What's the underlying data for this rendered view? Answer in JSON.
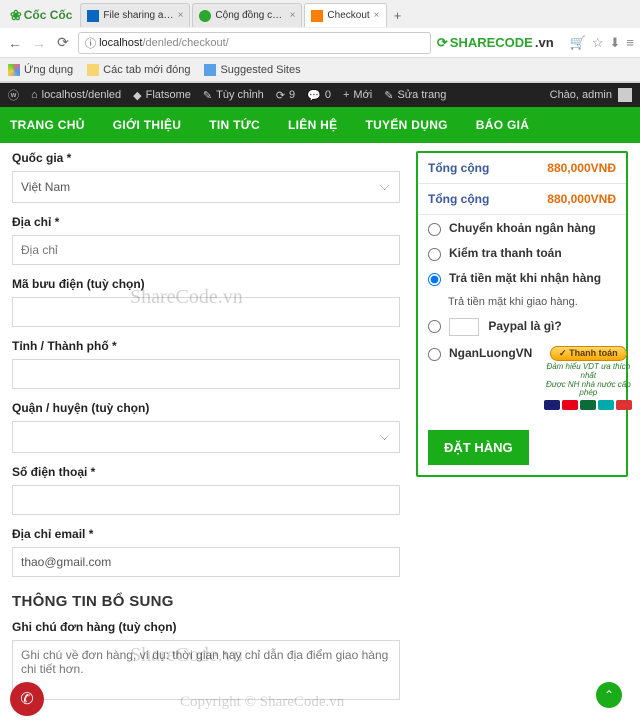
{
  "browser": {
    "app_name": "Cốc Cốc",
    "tabs": [
      {
        "label": "File sharing and storage m",
        "favicon_color": "#0b66c3"
      },
      {
        "label": "Cộng đồng chia sẻ và do",
        "favicon_color": "#2ea52e"
      },
      {
        "label": "Checkout",
        "favicon_color": "#ff7e00",
        "active": true
      }
    ],
    "new_tab": "+",
    "url_info_icon": "ⓘ",
    "url_host": "localhost",
    "url_path": "/denled/checkout/",
    "bookmarks": [
      {
        "label": "Ứng dụng"
      },
      {
        "label": "Các tab mới đóng"
      },
      {
        "label": "Suggested Sites"
      }
    ]
  },
  "watermark": {
    "brand": "SHARECODE",
    "suffix": ".vn"
  },
  "wp_bar": {
    "site": "localhost/denled",
    "items": [
      "Flatsome",
      "Tùy chỉnh"
    ],
    "comments": "0",
    "updates": "9",
    "new": "Mới",
    "edit": "Sửa trang",
    "greeting": "Chào, admin"
  },
  "nav": [
    "TRANG CHỦ",
    "GIỚI THIỆU",
    "TIN TỨC",
    "LIÊN HỆ",
    "TUYỂN DỤNG",
    "BÁO GIÁ"
  ],
  "form": {
    "country_label": "Quốc gia *",
    "country_value": "Việt Nam",
    "address_label": "Địa chỉ *",
    "address_placeholder": "Địa chỉ",
    "zip_label": "Mã bưu điện (tuỳ chọn)",
    "city_label": "Tỉnh / Thành phố *",
    "district_label": "Quận / huyện (tuỳ chọn)",
    "phone_label": "Số điện thoại *",
    "email_label": "Địa chỉ email *",
    "email_value": "thao@gmail.com",
    "extra_heading": "THÔNG TIN BỔ SUNG",
    "notes_label": "Ghi chú đơn hàng (tuỳ chọn)",
    "notes_placeholder": "Ghi chú về đơn hàng, ví dụ: thời gian hay chỉ dẫn địa điểm giao hàng chi tiết hơn."
  },
  "summary": {
    "rows": [
      {
        "k": "Tổng cộng",
        "v": "880,000VNĐ"
      },
      {
        "k": "Tổng cộng",
        "v": "880,000VNĐ"
      }
    ],
    "payments": {
      "bank": "Chuyển khoản ngân hàng",
      "check": "Kiểm tra thanh toán",
      "cod": "Trả tiền mặt khi nhận hàng",
      "cod_note": "Trả tiền mặt khi giao hàng.",
      "paypal_q": "Paypal là gì?",
      "nganluong": "NganLuongVN",
      "nl_pill": "✓ Thanh toán",
      "nl_sub1": "Đảm hiểu VDT ưa thích nhất",
      "nl_sub2": "Được NH nhà nước cấp phép"
    },
    "order_btn": "ĐẶT HÀNG"
  },
  "watermarks": {
    "wm": "ShareCode.vn",
    "copyright": "Copyright © ShareCode.vn"
  }
}
